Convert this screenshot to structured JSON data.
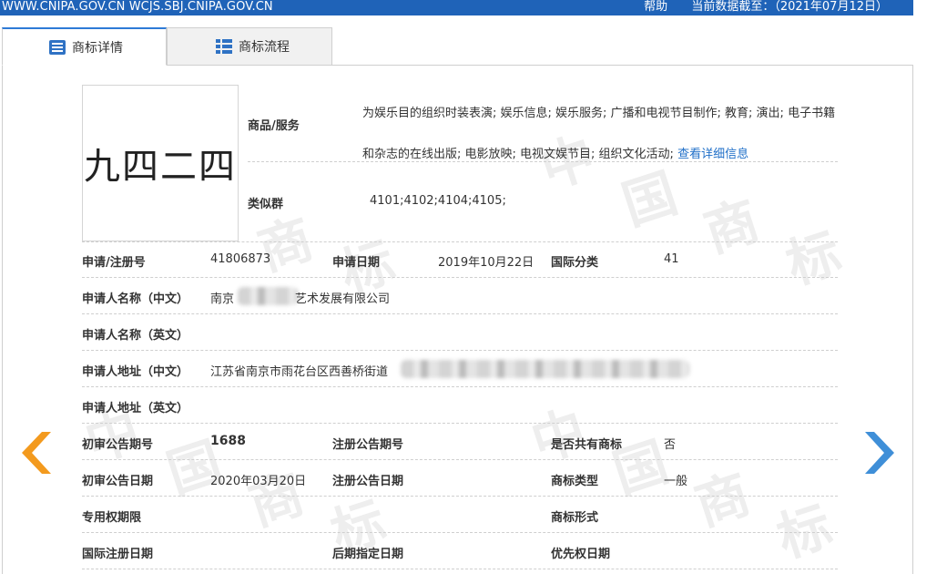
{
  "topbar": {
    "sites": "WWW.CNIPA.GOV.CN WCJS.SBJ.CNIPA.GOV.CN",
    "help": "帮助",
    "data_as_of": "当前数据截至：（2021年07月12日）"
  },
  "tabs": [
    {
      "label": "商标详情",
      "icon": "document-list-icon",
      "active": true
    },
    {
      "label": "商标流程",
      "icon": "flow-list-icon",
      "active": false
    }
  ],
  "watermark": [
    "中",
    "国",
    "商",
    "标"
  ],
  "trademark": {
    "image_text": "九四二四",
    "goods_label": "商品/服务",
    "goods_text": "为娱乐目的组织时装表演; 娱乐信息; 娱乐服务; 广播和电视节目制作; 教育; 演出; 电子书籍和杂志的在线出版; 电影放映; 电视文娱节目; 组织文化活动; ",
    "goods_link": "查看详细信息",
    "similar_label": "类似群",
    "similar_value": "4101;4102;4104;4105;"
  },
  "fields": {
    "reg_no_label": "申请/注册号",
    "reg_no": "41806873",
    "app_date_label": "申请日期",
    "app_date": "2019年10月22日",
    "intl_class_label": "国际分类",
    "intl_class": "41",
    "applicant_cn_label": "申请人名称（中文）",
    "applicant_cn_prefix": "南京",
    "applicant_cn_suffix": "艺术发展有限公司",
    "applicant_en_label": "申请人名称（英文）",
    "address_cn_label": "申请人地址（中文）",
    "address_cn": "江苏省南京市雨花台区西善桥街道",
    "address_en_label": "申请人地址（英文）",
    "prelim_pub_no_label": "初审公告期号",
    "prelim_pub_no": "1688",
    "reg_pub_no_label": "注册公告期号",
    "shared_label": "是否共有商标",
    "shared": "否",
    "prelim_pub_date_label": "初审公告日期",
    "prelim_pub_date": "2020年03月20日",
    "reg_pub_date_label": "注册公告日期",
    "mark_type_label": "商标类型",
    "mark_type": "一般",
    "exclusive_term_label": "专用权期限",
    "mark_form_label": "商标形式",
    "intl_reg_date_label": "国际注册日期",
    "later_designation_label": "后期指定日期",
    "priority_date_label": "优先权日期"
  },
  "nav": {
    "prev_icon": "chevron-left-icon",
    "next_icon": "chevron-right-icon",
    "prev_color": "#f39a1e",
    "next_color": "#3f8fd8"
  }
}
